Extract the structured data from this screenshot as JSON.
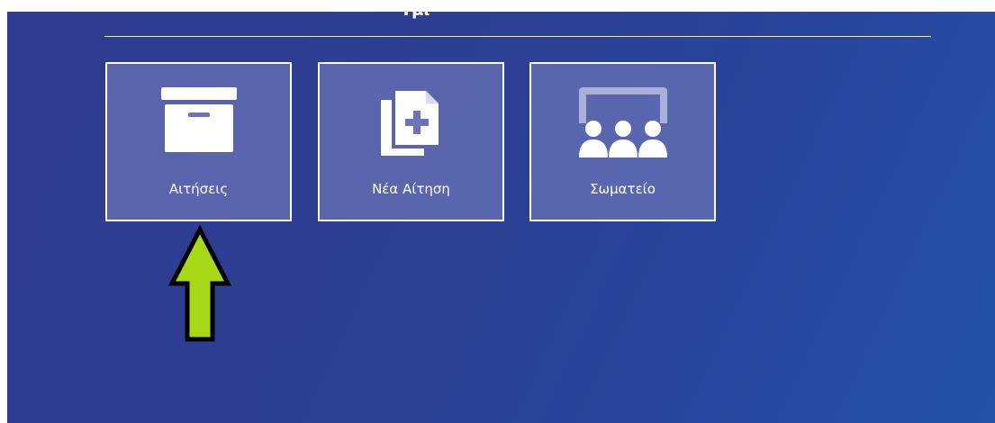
{
  "header": {
    "title_fragment": "“Τμι"
  },
  "tiles": [
    {
      "label": "Αιτήσεις",
      "icon": "archive-box-icon"
    },
    {
      "label": "Νέα Αίτηση",
      "icon": "new-document-icon"
    },
    {
      "label": "Σωματείο",
      "icon": "union-members-icon"
    }
  ],
  "annotation": {
    "icon": "arrow-up-icon",
    "color": "#a6d818"
  },
  "colors": {
    "tile_bg": "#6c74b9",
    "icon": "#ffffff",
    "icon_dim": "#aab0d8"
  }
}
